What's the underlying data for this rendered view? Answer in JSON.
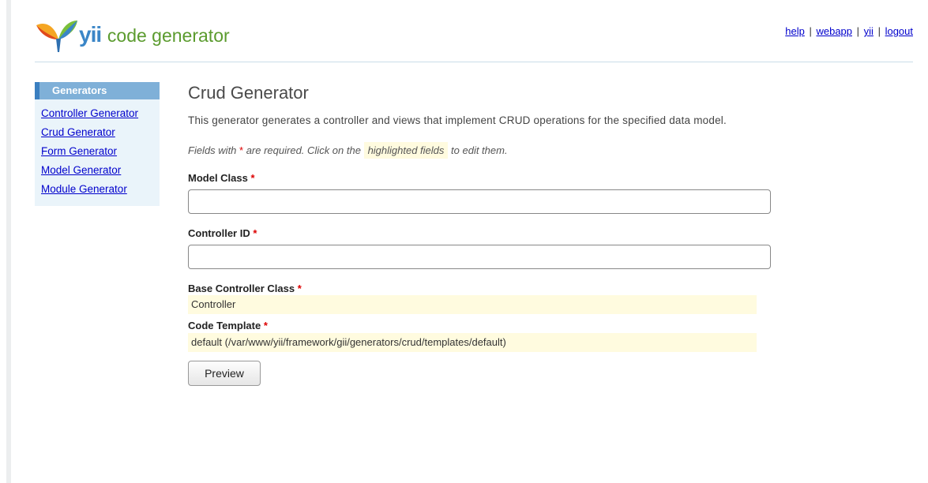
{
  "header": {
    "logo_brand": "yii",
    "logo_text": "code generator",
    "links": [
      "help",
      "webapp",
      "yii",
      "logout"
    ],
    "separator": "|"
  },
  "sidebar": {
    "title": "Generators",
    "items": [
      "Controller Generator",
      "Crud Generator",
      "Form Generator",
      "Model Generator",
      "Module Generator"
    ]
  },
  "main": {
    "title": "Crud Generator",
    "description": "This generator generates a controller and views that implement CRUD operations for the specified data model.",
    "note_prefix": "Fields with ",
    "note_required": "*",
    "note_middle": " are required. Click on the ",
    "note_highlight": "highlighted fields",
    "note_suffix": " to edit them.",
    "required_mark": "*",
    "model_class": {
      "label": "Model Class ",
      "value": ""
    },
    "controller_id": {
      "label": "Controller ID ",
      "value": ""
    },
    "base_controller": {
      "label": "Base Controller Class ",
      "value": "Controller"
    },
    "code_template": {
      "label": "Code Template ",
      "value": "default (/var/www/yii/framework/gii/generators/crud/templates/default)"
    },
    "preview_label": "Preview"
  },
  "colors": {
    "brand_blue": "#3b86c7",
    "brand_green": "#5b9b2e",
    "sidebar_header": "#7fb0d8",
    "highlight": "#fffbdf",
    "required": "#dd0000",
    "link": "#0000cc"
  }
}
